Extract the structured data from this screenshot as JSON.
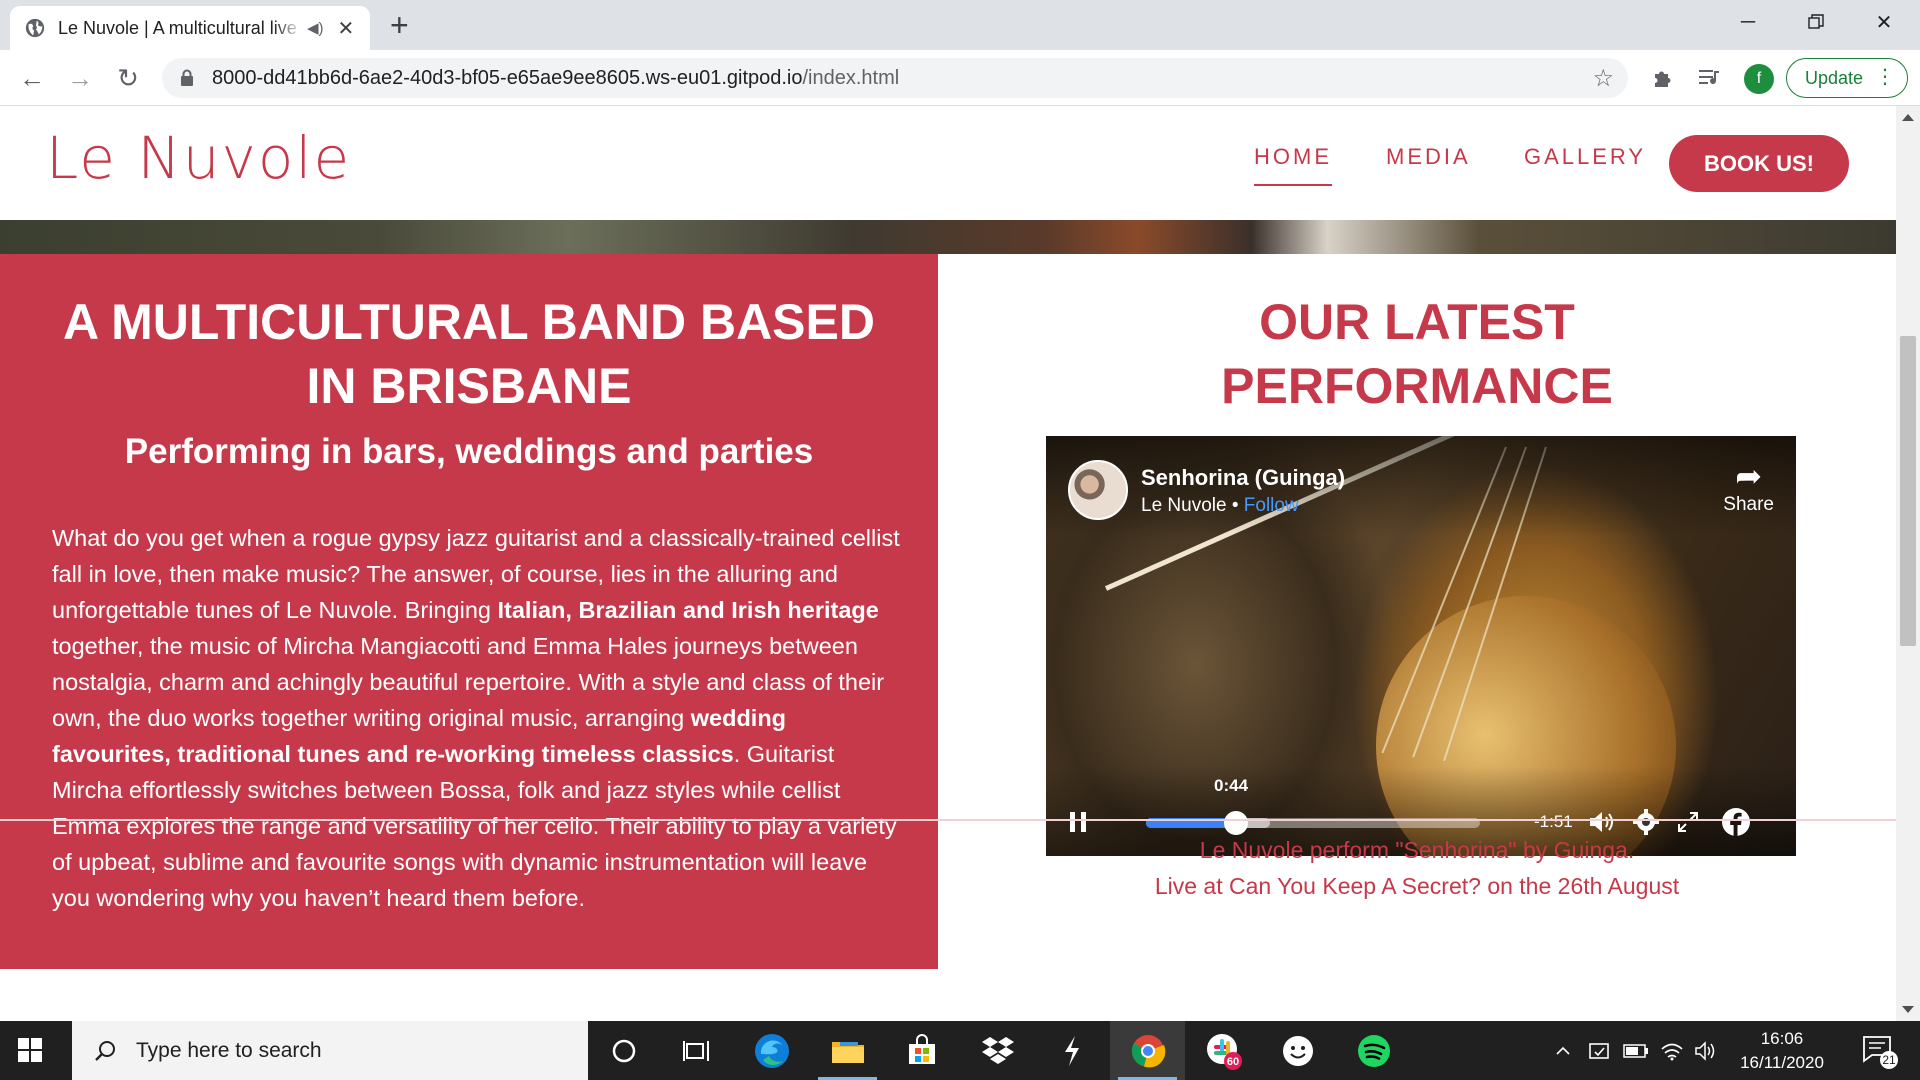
{
  "browser": {
    "tab_title": "Le Nuvole | A multicultural live band based in Brisbane",
    "url_host": "8000-dd41bb6d-6ae2-40d3-bf05-e65ae9ee8605.ws-eu01.gitpod.io",
    "url_path": "/index.html",
    "profile_initial": "f",
    "update_label": "Update"
  },
  "site": {
    "logo": "Le Nuvole",
    "nav": [
      {
        "label": "HOME",
        "active": true
      },
      {
        "label": "MEDIA",
        "active": false
      },
      {
        "label": "GALLERY",
        "active": false
      }
    ],
    "cta": "BOOK US!"
  },
  "left": {
    "heading_line1": "A MULTICULTURAL BAND BASED",
    "heading_line2": "IN BRISBANE",
    "subheading": "Performing in bars, weddings and parties",
    "p1": "What do you get when a rogue gypsy jazz guitarist and a classically-trained cellist fall in love, then make music? The answer, of course, lies in the alluring and unforgettable tunes of Le Nuvole. Bringing ",
    "b1": "Italian, Brazilian and Irish heritage",
    "p2": " together, the music of Mircha Mangiacotti and Emma Hales journeys between nostalgia, charm and achingly beautiful repertoire. With a style and class of their own, the duo works together writing original music, arranging ",
    "b2": "wedding favourites, traditional tunes and re-working timeless classics",
    "p3": ". Guitarist Mircha effortlessly switches between Bossa, folk and jazz styles while cellist Emma explores the range and versatility of her cello. Their ability to play a variety of upbeat, sublime and favourite songs with dynamic instrumentation will leave you wondering why you haven’t heard them before."
  },
  "right": {
    "heading_line1": "OUR LATEST",
    "heading_line2": "PERFORMANCE",
    "video": {
      "title": "Senhorina (Guinga)",
      "page": "Le Nuvole",
      "separator": "•",
      "follow": "Follow",
      "share": "Share",
      "current_time": "0:44",
      "remaining": "-1:51",
      "played_fraction": 0.27,
      "buffered_fraction": 0.37
    },
    "caption_line1": "Le Nuvole perform \"Senhorina\" by Guinga.",
    "caption_line2": "Live at Can You Keep A Secret? on the 26th August"
  },
  "taskbar": {
    "search_placeholder": "Type here to search",
    "time": "16:06",
    "date": "16/11/2020",
    "notification_count": "21",
    "slack_badge": "60"
  },
  "colors": {
    "brand": "#c6394a",
    "chrome_bg": "#dee1e6",
    "taskbar": "#202020",
    "update_green": "#188038"
  }
}
